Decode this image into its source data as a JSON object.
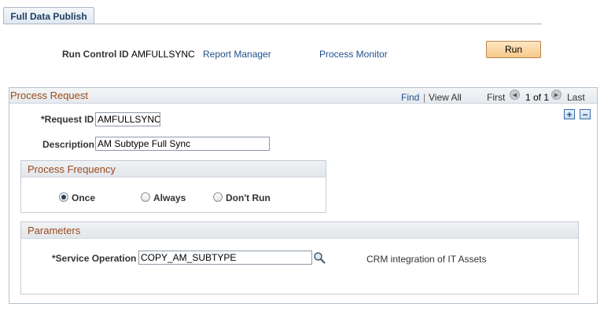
{
  "tab": {
    "label": "Full Data Publish"
  },
  "header": {
    "run_control_label": "Run Control ID",
    "run_control_value": "AMFULLSYNC",
    "report_manager": "Report Manager",
    "process_monitor": "Process Monitor",
    "run_button": "Run"
  },
  "process_request": {
    "title": "Process Request",
    "find": "Find",
    "separator": "|",
    "view_all": "View All",
    "first": "First",
    "page_info": "1 of 1",
    "last": "Last",
    "request_id_label": "*Request ID",
    "request_id_value": "AMFULLSYNC",
    "description_label": "Description",
    "description_value": "AM Subtype Full Sync",
    "add_icon": "+",
    "remove_icon": "−"
  },
  "process_frequency": {
    "title": "Process Frequency",
    "options": [
      "Once",
      "Always",
      "Don't Run"
    ],
    "selected": "Once"
  },
  "parameters": {
    "title": "Parameters",
    "service_operation_label": "*Service Operation",
    "service_operation_value": "COPY_AM_SUBTYPE",
    "description": "CRM integration of IT Assets"
  }
}
